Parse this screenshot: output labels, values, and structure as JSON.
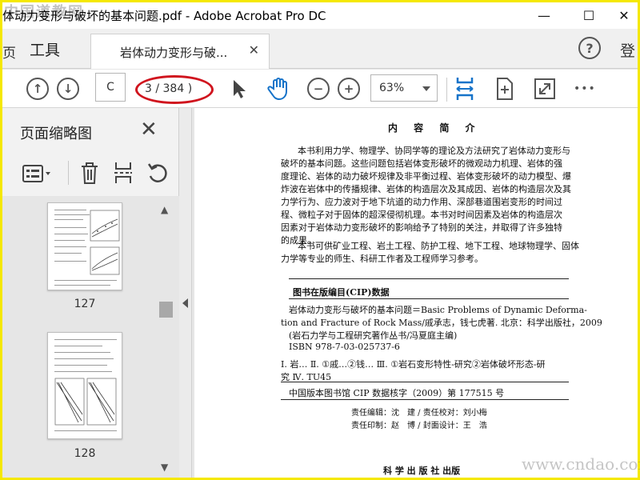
{
  "window": {
    "title": "体动力变形与破坏的基本问题.pdf - Adobe Acrobat Pro DC",
    "watermark_top": "中国道教网",
    "minimize": "—",
    "maximize": "☐",
    "close": "✕"
  },
  "tabs": {
    "edge_label": "页",
    "tools_label": "工具",
    "doc_tab_label": "岩体动力变形与破...",
    "doc_tab_close": "✕",
    "help": "?",
    "login_label": "登"
  },
  "toolbar": {
    "page_input_value": "C",
    "page_count": "3 / 384 )",
    "zoom_value": "63%",
    "more": "•••"
  },
  "left_panel": {
    "title": "页面缩略图",
    "close": "✕",
    "thumbnails": [
      {
        "label": "127"
      },
      {
        "label": "128"
      }
    ]
  },
  "document": {
    "heading": "内 容 简 介",
    "intro_lines": [
      "本书利用力学、物理学、协同学等的理论及方法研究了岩体动力变形与",
      "破坏的基本问题。这些问题包括岩体变形破坏的微观动力机理、岩体的强",
      "度理论、岩体的动力破坏规律及非平衡过程、岩体变形破坏的动力模型、爆",
      "炸波在岩体中的传播规律、岩体的构造层次及其成因、岩体的构造层次及其",
      "力学行为、应力波对于地下坑道的动力作用、深部巷道围岩变形的时间过",
      "程、微粒子对于固体的超深侵彻机理。本书对时间因素及岩体的构造层次",
      "因素对于岩体动力变形破坏的影响给予了特别的关注，并取得了许多独特",
      "的成果。"
    ],
    "audience_lines": [
      "本书可供矿业工程、岩土工程、防护工程、地下工程、地球物理学、固体",
      "力学等专业的师生、科研工作者及工程师学习参考。"
    ],
    "cip_heading": "图书在版编目(CIP)数据",
    "cip_lines": [
      "岩体动力变形与破坏的基本问题＝Basic Problems of Dynamic Deforma-",
      "tion and Fracture of Rock Mass/戚承志，钱七虎著. 北京：科学出版社，2009",
      "(岩石力学与工程研究著作丛书/冯夏庭主编)",
      "ISBN 978-7-03-025737-6",
      "Ⅰ. 岩…  Ⅱ. ①戚…②钱…  Ⅲ. ①岩石变形特性-研究②岩体破坏形态-研",
      "究  Ⅳ. TU45"
    ],
    "cip_number": "中国版本图书馆 CIP 数据核字（2009）第 177515 号",
    "editor_line": "责任编辑：沈　建 / 责任校对：刘小梅",
    "print_line": "责任印制：赵　博 / 封面设计：王　浩",
    "publisher_line": "科 学 出 版 社  出版"
  },
  "watermark_bottom": "www.cndao.com"
}
